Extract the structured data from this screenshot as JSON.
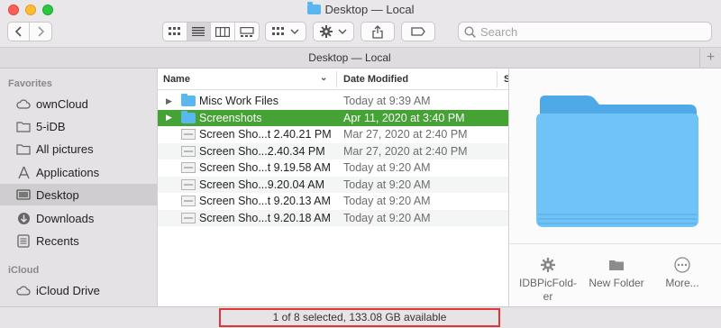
{
  "window": {
    "title": "Desktop — Local",
    "path_title": "Desktop — Local"
  },
  "toolbar": {
    "back_icon": "chevron-left-icon",
    "forward_icon": "chevron-right-icon",
    "view_modes": [
      "icon-view",
      "list-view",
      "column-view",
      "gallery-view"
    ],
    "active_view": "list-view",
    "search_placeholder": "Search"
  },
  "sidebar": {
    "favorites_header": "Favorites",
    "icloud_header": "iCloud",
    "items": [
      {
        "label": "ownCloud",
        "icon": "cloud-icon"
      },
      {
        "label": "5-iDB",
        "icon": "folder-icon"
      },
      {
        "label": "All pictures",
        "icon": "folder-icon"
      },
      {
        "label": "Applications",
        "icon": "applications-icon"
      },
      {
        "label": "Desktop",
        "icon": "desktop-icon",
        "selected": true
      },
      {
        "label": "Downloads",
        "icon": "downloads-icon"
      },
      {
        "label": "Recents",
        "icon": "recents-icon"
      },
      {
        "label": "iCloud Drive",
        "icon": "cloud-icon"
      }
    ]
  },
  "list": {
    "columns": {
      "name": "Name",
      "date": "Date Modified",
      "size": "S"
    },
    "rows": [
      {
        "name": "Misc Work Files",
        "date": "Today at 9:39 AM",
        "type": "folder"
      },
      {
        "name": "Screenshots",
        "date": "Apr 11, 2020 at 3:40 PM",
        "type": "folder",
        "selected": true
      },
      {
        "name": "Screen Sho...t 2.40.21 PM",
        "date": "Mar 27, 2020 at 2:40 PM",
        "type": "image"
      },
      {
        "name": "Screen Sho...2.40.34 PM",
        "date": "Mar 27, 2020 at 2:40 PM",
        "type": "image"
      },
      {
        "name": "Screen Sho...t 9.19.58 AM",
        "date": "Today at 9:20 AM",
        "type": "image"
      },
      {
        "name": "Screen Sho...9.20.04 AM",
        "date": "Today at 9:20 AM",
        "type": "image"
      },
      {
        "name": "Screen Sho...t 9.20.13 AM",
        "date": "Today at 9:20 AM",
        "type": "image"
      },
      {
        "name": "Screen Sho...t 9.20.18 AM",
        "date": "Today at 9:20 AM",
        "type": "image"
      }
    ]
  },
  "preview": {
    "actions": [
      {
        "label": "IDBPicFold-\ner",
        "icon": "gear-icon"
      },
      {
        "label": "New Folder",
        "icon": "folder-icon"
      },
      {
        "label": "More...",
        "icon": "more-icon"
      }
    ]
  },
  "status": {
    "text": "1 of 8 selected, 133.08 GB available"
  },
  "colors": {
    "selection": "#45a235",
    "folder": "#5ab7f0",
    "highlight_box": "#e23636"
  }
}
